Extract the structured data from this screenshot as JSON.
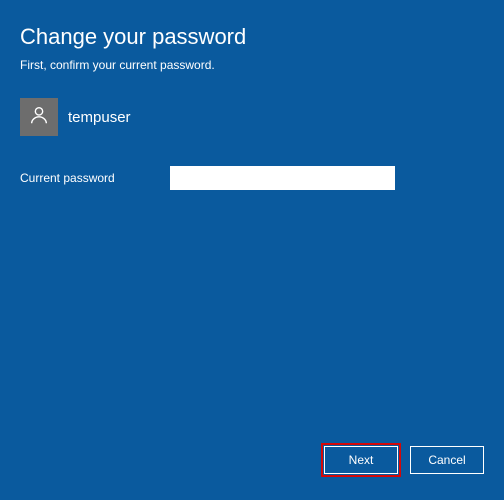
{
  "dialog": {
    "title": "Change your password",
    "subtitle": "First, confirm your current password."
  },
  "user": {
    "name": "tempuser"
  },
  "form": {
    "current_password_label": "Current password",
    "current_password_value": ""
  },
  "buttons": {
    "next": "Next",
    "cancel": "Cancel"
  }
}
